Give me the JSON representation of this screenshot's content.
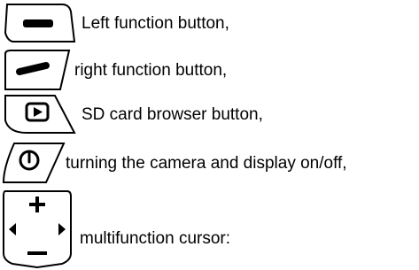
{
  "items": [
    {
      "icon": "left-function-button-icon",
      "label": "Left function button,"
    },
    {
      "icon": "right-function-button-icon",
      "label": "right function button,"
    },
    {
      "icon": "sd-card-browser-button-icon",
      "label": "SD card browser button,"
    },
    {
      "icon": "power-button-icon",
      "label": "turning the camera and display on/off,"
    },
    {
      "icon": "multifunction-cursor-icon",
      "label": "multifunction cursor:"
    }
  ],
  "colors": {
    "ink": "#000000",
    "background": "#ffffff"
  }
}
